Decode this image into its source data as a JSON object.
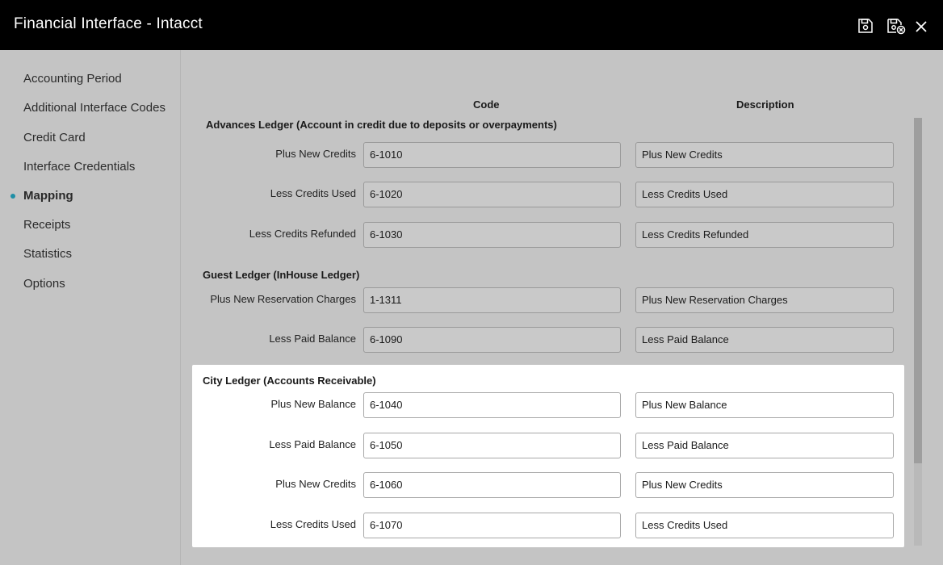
{
  "window": {
    "title": "Financial Interface - Intacct"
  },
  "toolbar": {
    "save_icon": "save-icon",
    "save_close_icon": "save-close-icon",
    "close_icon": "close-icon"
  },
  "sidebar": {
    "items": [
      {
        "label": "Accounting Period",
        "active": false
      },
      {
        "label": "Additional Interface Codes",
        "active": false
      },
      {
        "label": "Credit Card",
        "active": false
      },
      {
        "label": "Interface Credentials",
        "active": false
      },
      {
        "label": "Mapping",
        "active": true
      },
      {
        "label": "Receipts",
        "active": false
      },
      {
        "label": "Statistics",
        "active": false
      },
      {
        "label": "Options",
        "active": false
      }
    ]
  },
  "columns": {
    "code": "Code",
    "description": "Description"
  },
  "sections": {
    "advances": {
      "title": "Advances Ledger (Account in credit due to deposits or overpayments)",
      "rows": [
        {
          "label": "Plus New Credits",
          "code": "6-1010",
          "description": "Plus New Credits"
        },
        {
          "label": "Less Credits Used",
          "code": "6-1020",
          "description": "Less Credits Used"
        },
        {
          "label": "Less Credits Refunded",
          "code": "6-1030",
          "description": "Less Credits Refunded"
        }
      ]
    },
    "guest": {
      "title": "Guest Ledger (InHouse Ledger)",
      "rows": [
        {
          "label": "Plus New Reservation Charges",
          "code": "1-1311",
          "description": "Plus New Reservation Charges"
        },
        {
          "label": "Less Paid Balance",
          "code": "6-1090",
          "description": "Less Paid Balance"
        }
      ]
    },
    "city": {
      "title": "City Ledger (Accounts Receivable)",
      "rows": [
        {
          "label": "Plus New Balance",
          "code": "6-1040",
          "description": "Plus New Balance"
        },
        {
          "label": "Less Paid Balance",
          "code": "6-1050",
          "description": "Less Paid Balance"
        },
        {
          "label": "Plus New Credits",
          "code": "6-1060",
          "description": "Plus New Credits"
        },
        {
          "label": "Less Credits Used",
          "code": "6-1070",
          "description": "Less Credits Used"
        }
      ]
    }
  },
  "colors": {
    "titlebar": "#000000",
    "background": "#c4c4c4",
    "active_dot": "#1f8fa6",
    "highlight_panel": "#ffffff"
  }
}
